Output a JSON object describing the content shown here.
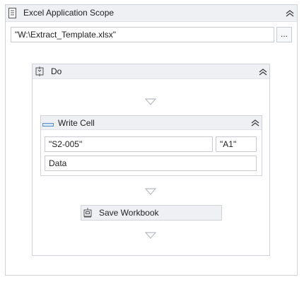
{
  "scope": {
    "title": "Excel Application Scope",
    "icon": "excel-scope-icon",
    "path_value": "\"W:\\Extract_Template.xlsx\"",
    "browse_label": "..."
  },
  "do": {
    "title": "Do",
    "icon": "sequence-icon"
  },
  "write_cell": {
    "title": "Write Cell",
    "icon": "write-cell-icon",
    "sheet_value": "\"S2-005\"",
    "range_value": "\"A1\"",
    "value_field": "Data"
  },
  "save_workbook": {
    "title": "Save Workbook",
    "icon": "save-workbook-icon"
  },
  "colors": {
    "header_bg": "#eef0f3",
    "border": "#d0d4d9",
    "drop_arrow": "#b7bcc2"
  }
}
